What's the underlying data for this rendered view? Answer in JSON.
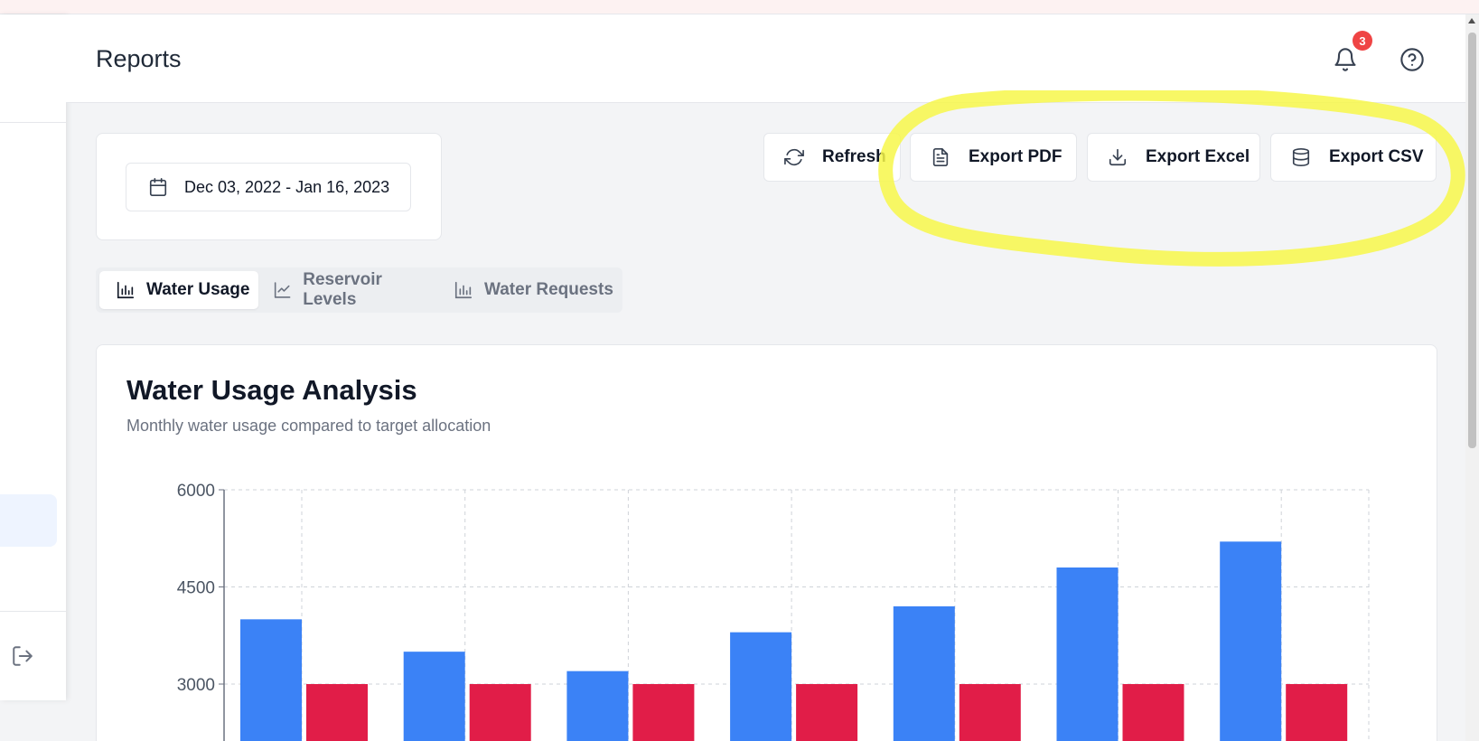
{
  "header": {
    "title": "Reports",
    "notification_count": "3"
  },
  "date_range": {
    "label": "Dec 03, 2022 - Jan 16, 2023"
  },
  "actions": {
    "refresh": "Refresh",
    "export_pdf": "Export PDF",
    "export_excel": "Export Excel",
    "export_csv": "Export CSV"
  },
  "tabs": [
    {
      "label": "Water Usage",
      "icon": "bar-chart-icon",
      "active": true
    },
    {
      "label": "Reservoir Levels",
      "icon": "line-chart-icon",
      "active": false
    },
    {
      "label": "Water Requests",
      "icon": "bar-chart-icon",
      "active": false
    }
  ],
  "chart": {
    "title": "Water Usage Analysis",
    "subtitle": "Monthly water usage compared to target allocation"
  },
  "colors": {
    "usage": "#3b82f6",
    "target": "#e11d48",
    "highlight": "#f7f74a"
  },
  "chart_data": {
    "type": "bar",
    "title": "Water Usage Analysis",
    "subtitle": "Monthly water usage compared to target allocation",
    "xlabel": "",
    "ylabel": "",
    "yticks": [
      3000,
      4500,
      6000
    ],
    "ylim": [
      0,
      6000
    ],
    "grid": true,
    "series": [
      {
        "values": [
          4000,
          3500,
          3200,
          3800,
          4200,
          4800,
          5200
        ],
        "color": "#3b82f6"
      },
      {
        "values": [
          3000,
          3000,
          3000,
          3000,
          3000,
          3000,
          3000
        ],
        "color": "#e11d48"
      }
    ]
  }
}
